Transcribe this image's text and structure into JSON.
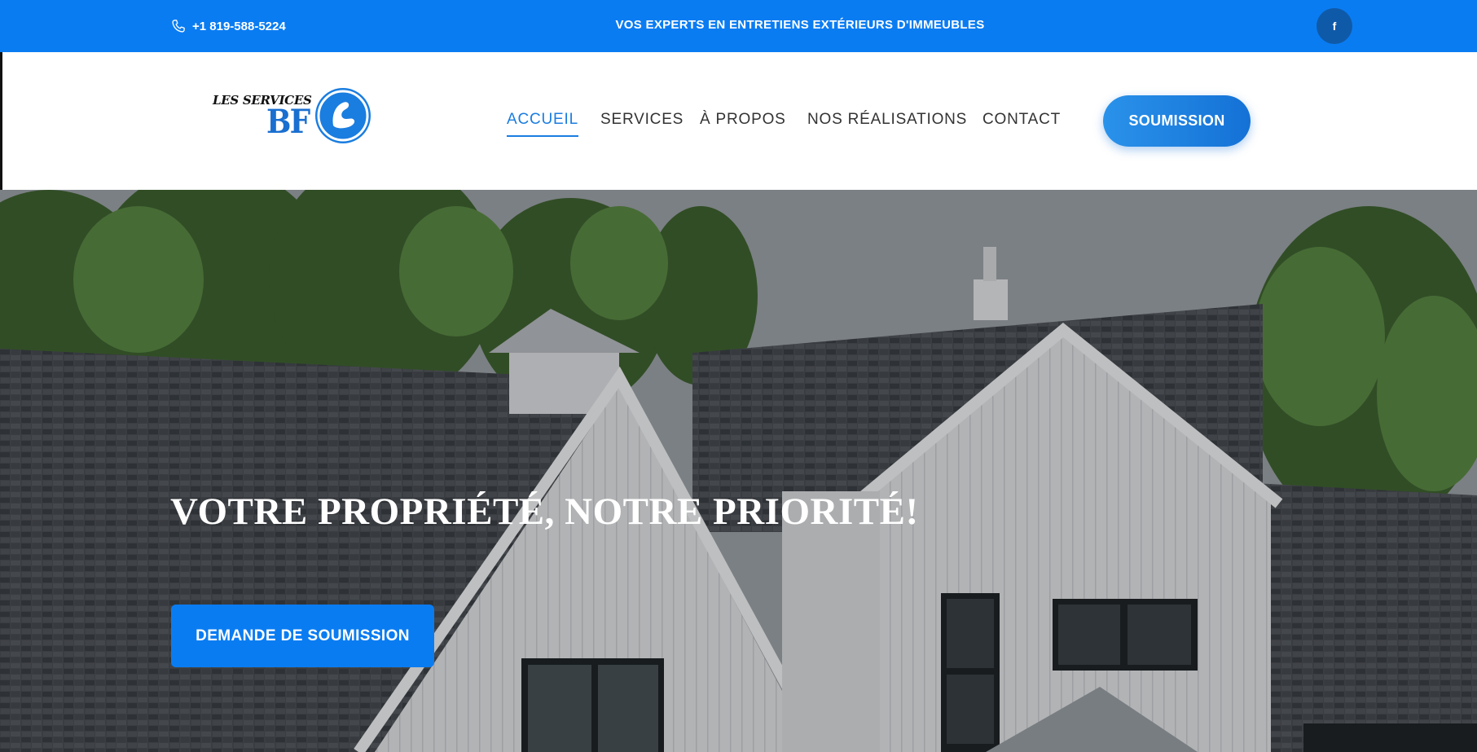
{
  "topbar": {
    "phone": "+1 819-588-5224",
    "tagline": "VOS EXPERTS EN ENTRETIENS EXTÉRIEURS D'IMMEUBLES",
    "facebook_label": "f"
  },
  "logo": {
    "line1": "LES SERVICES",
    "line2": "BF"
  },
  "nav": {
    "items": [
      {
        "label": "ACCUEIL",
        "active": true
      },
      {
        "label": "SERVICES",
        "active": false
      },
      {
        "label": "À PROPOS",
        "active": false
      },
      {
        "label": "NOS RÉALISATIONS",
        "active": false
      },
      {
        "label": "CONTACT",
        "active": false
      }
    ],
    "cta": "SOUMISSION"
  },
  "hero": {
    "title": "VOTRE PROPRIÉTÉ, NOTRE PRIORITÉ!",
    "cta": "DEMANDE DE SOUMISSION"
  },
  "colors": {
    "brand_blue": "#0a7cf2",
    "nav_active": "#1a7de0",
    "facebook_bg": "#0f5aa8"
  }
}
